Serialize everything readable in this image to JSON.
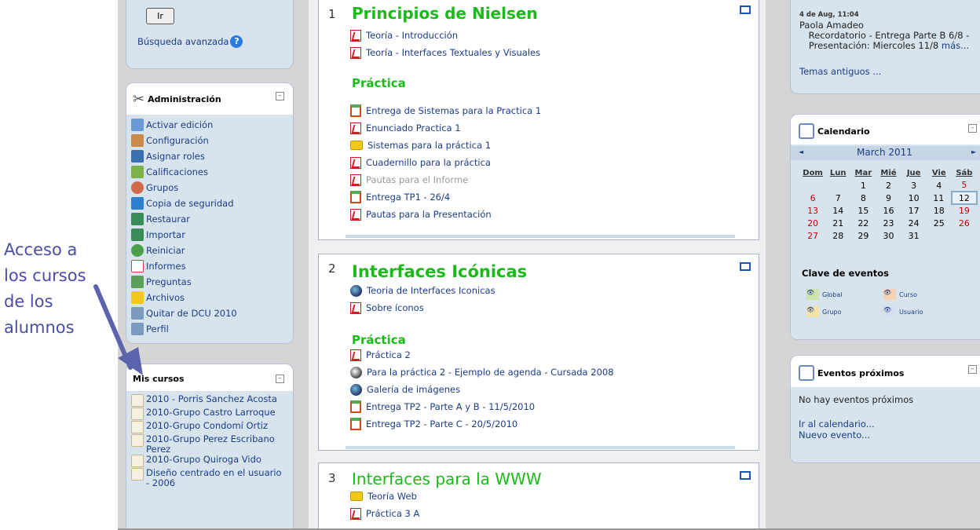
{
  "annotation": {
    "lines": [
      "Acceso a",
      "los cursos",
      "de los",
      "alumnos"
    ]
  },
  "search": {
    "button": "Ir",
    "advanced": "Búsqueda avanzada"
  },
  "admin": {
    "title": "Administración",
    "items": [
      "Activar edición",
      "Configuración",
      "Asignar roles",
      "Calificaciones",
      "Grupos",
      "Copia de seguridad",
      "Restaurar",
      "Importar",
      "Reiniciar",
      "Informes",
      "Preguntas",
      "Archivos",
      "Quitar de DCU 2010",
      "Perfil"
    ]
  },
  "mycourses": {
    "title": "Mis cursos",
    "items": [
      "2010 - Porris Sanchez Acosta",
      "2010-Grupo Castro Larroque",
      "2010-Grupo Condomí Ortiz",
      "2010-Grupo Perez Escribano Perez",
      "2010-Grupo Quiroga Vido",
      "Diseño centrado en el usuario - 2006"
    ]
  },
  "sections": [
    {
      "num": "1",
      "title": "Principios de Nielsen",
      "items": [
        "Teoría - Introducción",
        "Teoría - Interfaces Textuales y Visuales"
      ],
      "practice": "Práctica",
      "practice_items": [
        "Entrega de Sistemas para la Practica 1",
        "Enunciado Practica 1",
        "Sistemas para la práctica 1",
        "Cuadernillo para la práctica",
        "Pautas para el Informe",
        "Entrega TP1 - 26/4",
        "Pautas para la Presentación"
      ]
    },
    {
      "num": "2",
      "title": "Interfaces Icónicas",
      "items": [
        "Teoria de Interfaces Iconicas",
        "Sobre íconos"
      ],
      "practice": "Práctica",
      "practice_items": [
        "Práctica 2",
        "Para la práctica 2 - Ejemplo de agenda - Cursada 2008",
        "Galería de imágenes",
        "Entrega TP2 - Parte A y B - 11/5/2010",
        "Entrega TP2 - Parte C - 20/5/2010"
      ]
    },
    {
      "num": "3",
      "title": "Interfaces para la WWW",
      "items": [
        "Teoría Web",
        "Práctica 3 A"
      ]
    }
  ],
  "news": {
    "date": "4 de Aug, 11:04",
    "author": "Paola Amadeo",
    "text": "Recordatorio - Entrega Parte B 6/8 - Presentación: Miercoles 11/8",
    "more": "más...",
    "older": "Temas antiguos ..."
  },
  "calendar": {
    "title": "Calendario",
    "month": "March 2011",
    "prev": "◄",
    "next": "►",
    "days": [
      "Dom",
      "Lun",
      "Mar",
      "Mié",
      "Jue",
      "Vie",
      "Sáb"
    ],
    "weeks": [
      [
        "",
        "",
        "1",
        "2",
        "3",
        "4",
        "5"
      ],
      [
        "6",
        "7",
        "8",
        "9",
        "10",
        "11",
        "12"
      ],
      [
        "13",
        "14",
        "15",
        "16",
        "17",
        "18",
        "19"
      ],
      [
        "20",
        "21",
        "22",
        "23",
        "24",
        "25",
        "26"
      ],
      [
        "27",
        "28",
        "29",
        "30",
        "31",
        "",
        ""
      ]
    ],
    "today": "12",
    "key_title": "Clave de eventos",
    "key": [
      "Global",
      "Curso",
      "Grupo",
      "Usuario"
    ]
  },
  "upcoming": {
    "title": "Eventos próximos",
    "none": "No hay eventos próximos",
    "goto": "Ir al calendario...",
    "new": "Nuevo evento..."
  },
  "colors": {
    "section_title": "#19bb19",
    "link": "#1b3c8a",
    "block_bg": "#d7e4ee",
    "annotation": "#4a4ea3"
  }
}
